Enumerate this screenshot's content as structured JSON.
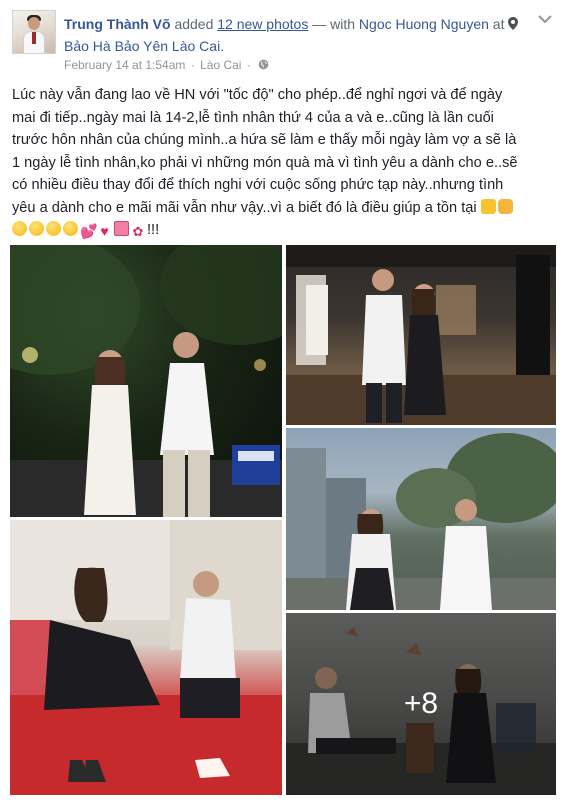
{
  "post": {
    "author": "Trung Thành Võ",
    "action_text": "added",
    "photos_link": "12 new photos",
    "with_text": "— with",
    "tagged_person": "Ngoc Huong Nguyen",
    "at_text": "at",
    "location": "Bảo Hà Bảo Yên Lào Cai.",
    "timestamp": "February 14 at 1:54am",
    "meta_location": "Lào Cai",
    "meta_dot": "·",
    "privacy_icon": "globe-icon",
    "menu_icon": "chevron-down-icon"
  },
  "body": {
    "lines": [
      "Lúc này vẫn đang lao về HN với \"tốc độ\" cho phép..để nghỉ ngơi và để ngày",
      "mai đi tiếp..ngày mai là 14-2,lễ tình nhân thứ 4 của a và e..cũng là lần cuối",
      "trước hôn nhân của chúng mình..a hứa sẽ làm e thấy mỗi ngày làm vợ a sẽ là",
      "1 ngày lễ tình nhân,ko phải vì những món quà mà vì tình yêu a dành cho e..sẽ",
      "có nhiều điều thay đổi để thích nghi với cuộc sống phức tạp này..nhưng tình",
      "yêu a dành cho e mãi mãi vẫn như vậy..vì a biết đó là điều giúp a tồn tại"
    ],
    "last_line_suffix": "!!!",
    "emoji": [
      "thumbs-up",
      "clapping-hands",
      "kissing-face",
      "smiling-face",
      "smiling-face",
      "kissing-face",
      "sparkling-heart",
      "red-heart",
      "gift",
      "bouquet"
    ]
  },
  "photos": {
    "count_overlay": "+8",
    "items": [
      "couple-at-night",
      "couple-in-hall",
      "couple-on-balcony",
      "shoe-fitting",
      "couple-in-lounge"
    ]
  }
}
